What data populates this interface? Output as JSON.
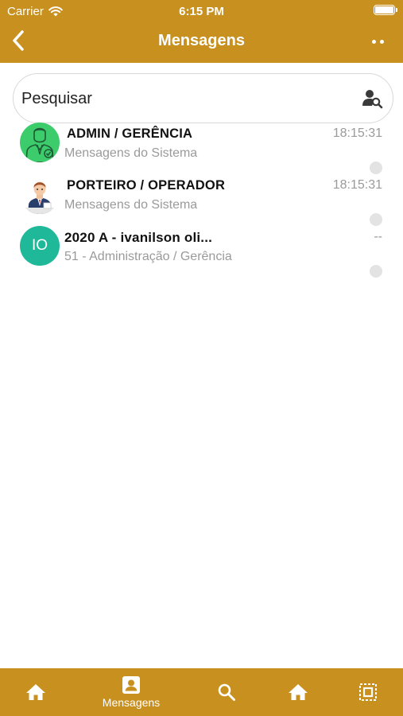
{
  "status_bar": {
    "carrier": "Carrier",
    "time": "6:15 PM"
  },
  "nav": {
    "title": "Mensagens"
  },
  "search": {
    "placeholder": "Pesquisar"
  },
  "conversations": [
    {
      "title": "ADMIN / GERÊNCIA",
      "subtitle": "Mensagens do Sistema",
      "time": "18:15:31"
    },
    {
      "title": "PORTEIRO / OPERADOR",
      "subtitle": "Mensagens do Sistema",
      "time": "18:15:31"
    },
    {
      "initials": "IO",
      "title": "2020 A - ivanilson oli...",
      "subtitle": "51 - Administração / Gerência",
      "time": "--"
    }
  ],
  "tabs": [
    {
      "icon": "home-icon"
    },
    {
      "icon": "contact-card-icon",
      "label": "Mensagens"
    },
    {
      "icon": "search-icon"
    },
    {
      "icon": "home-icon"
    },
    {
      "icon": "select-frame-icon"
    }
  ],
  "colors": {
    "brand": "#c8901f",
    "muted_text": "#9a9a9a",
    "initials_avatar": "#1fb99a",
    "admin_avatar": "#3ccc6c"
  }
}
